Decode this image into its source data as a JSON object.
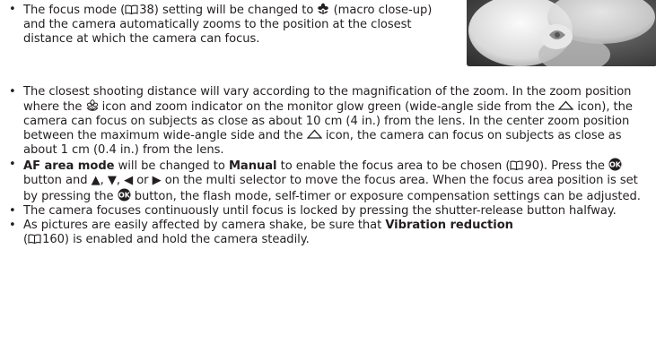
{
  "top_bullet": {
    "focus_mode_prefix": "The focus mode (",
    "focus_mode_page": "38",
    "focus_mode_setting": ") setting will be changed to",
    "macro_label": " (macro close-up) and the camera automatically zooms to the position at the closest distance at which the camera can focus."
  },
  "bullets": {
    "closest": {
      "part1": "The closest shooting distance will vary according to the magnification of the zoom. In the zoom position where the ",
      "part2": " icon and zoom indicator on the monitor glow green (wide-angle side from the ",
      "part3": " icon), the camera can focus on subjects as close as about 10 cm (4 in.) from the lens. In the center zoom position between the maximum wide-angle side and the ",
      "part4": " icon, the camera can focus on subjects as close as about 1 cm (0.4 in.) from the lens."
    },
    "af": {
      "bold1": "AF area mode",
      "part1": " will be changed to ",
      "bold2": "Manual",
      "part2": " to enable the focus area to be chosen (",
      "page": "90",
      "part3": "). Press the ",
      "part4": " button and ▲, ▼, ◀ or ▶ on the multi selector to move the focus area. When the focus area position is set by pressing the ",
      "part5": " button, the flash mode, self-timer or exposure compensation settings can be adjusted."
    },
    "continuous": "The camera focuses continuously until focus is locked by pressing the shutter-release button halfway.",
    "shake": {
      "part1": "As pictures are easily affected by camera shake, be sure that ",
      "bold": "Vibration reduction",
      "part2": "(",
      "page": "160",
      "part3": ") is enabled and hold the camera steadily."
    }
  },
  "colors": {
    "text": "#231f20"
  },
  "icons": [
    "reference-book-icon",
    "macro-flower-icon",
    "macro-flower-outline-icon",
    "zoom-triangle-icon",
    "ok-button-icon"
  ]
}
